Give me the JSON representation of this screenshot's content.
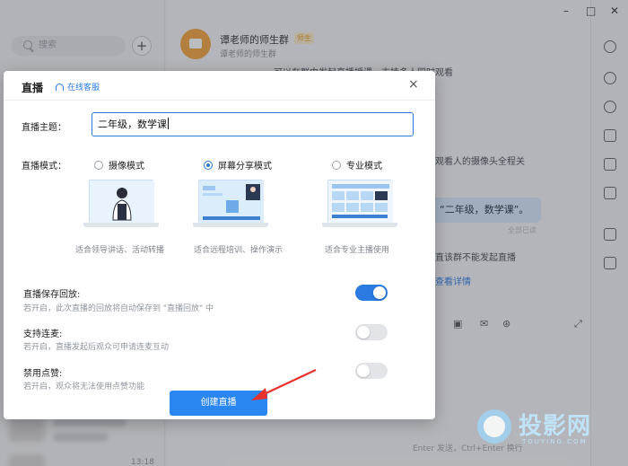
{
  "left": {
    "search_placeholder": "搜索",
    "add": "+",
    "time": "13:18"
  },
  "group": {
    "name": "谭老师的师生群",
    "tag": "师生",
    "sub": "谭老师的师生群"
  },
  "chat": {
    "line1": "可以在群内发起直播授课，支持多人同时观看",
    "line2": "观看人的摄像头全程关",
    "bubble": "“二年级，数学课”。",
    "all_read": "全部已读",
    "line3": "直该群不能发起直播",
    "link": "查看详情",
    "input_hint": "Enter 发送，Ctrl+Enter 换行"
  },
  "dialog": {
    "title": "直播",
    "service": "在线客服",
    "close": "×",
    "topic_label": "直播主题：",
    "topic_value": "二年级，数学课",
    "mode_label": "直播模式：",
    "modes": [
      {
        "label": "摄像模式",
        "caption": "适合领导讲话、活动转播",
        "selected": false
      },
      {
        "label": "屏幕分享模式",
        "caption": "适合远程培训、操作演示",
        "selected": true
      },
      {
        "label": "专业模式",
        "caption": "适合专业主播使用",
        "selected": false
      }
    ],
    "settings": [
      {
        "label": "直播保存回放:",
        "desc": "若开启，此次直播的回放将自动保存到 \"直播回放\" 中",
        "on": true
      },
      {
        "label": "支持连麦:",
        "desc": "若开启，直播发起后观众可申请连麦互动",
        "on": false
      },
      {
        "label": "禁用点赞:",
        "desc": "若开启，观众将无法使用点赞功能",
        "on": false
      }
    ],
    "create_button": "创建直播"
  },
  "watermark": {
    "text": "投影网",
    "sub": "TOUYING.COM"
  },
  "colors": {
    "accent": "#2a86f0",
    "arrow": "#e8302c"
  }
}
